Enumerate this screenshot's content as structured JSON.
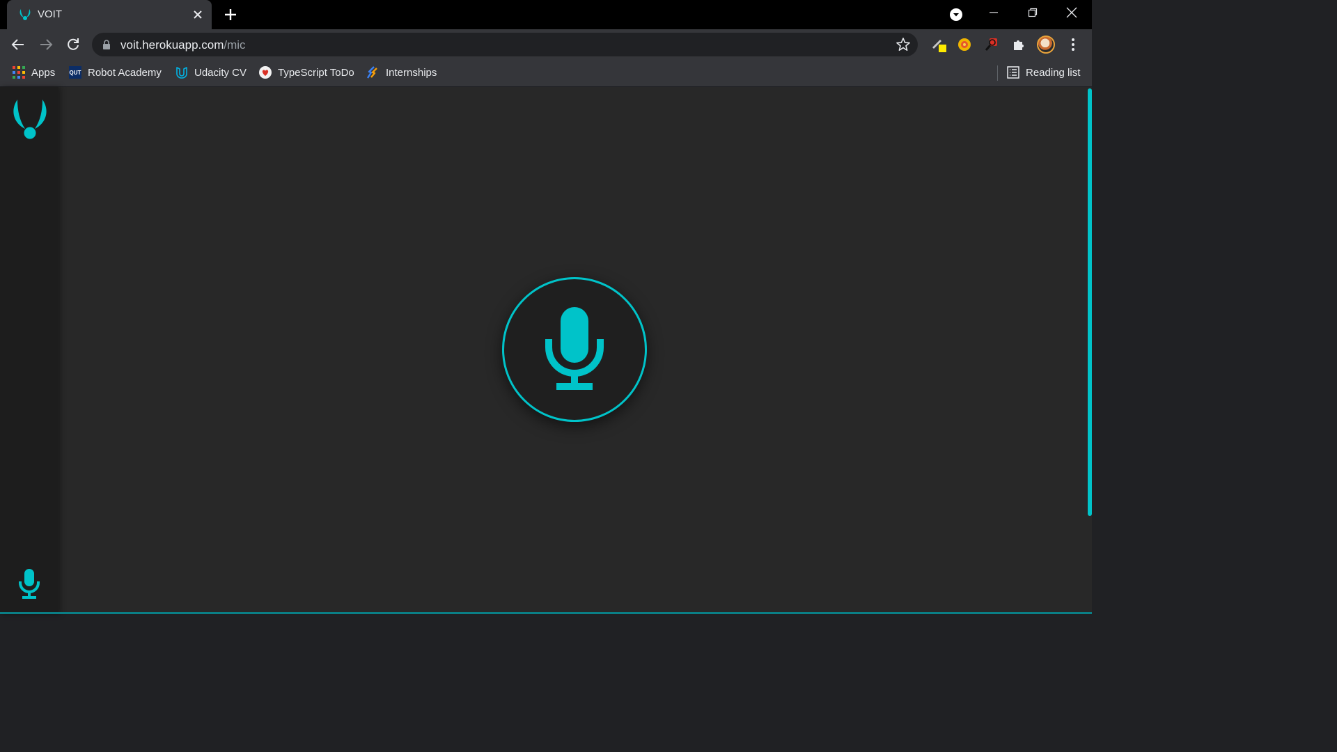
{
  "browser": {
    "tab": {
      "title": "VOIT"
    },
    "url": {
      "host": "voit.herokuapp.com",
      "path": "/mic"
    },
    "bookmarks": [
      {
        "label": "Apps",
        "icon": "apps-grid-icon"
      },
      {
        "label": "Robot Academy",
        "icon": "qut-icon",
        "badge": "QUT"
      },
      {
        "label": "Udacity CV",
        "icon": "udacity-icon"
      },
      {
        "label": "TypeScript ToDo",
        "icon": "typescript-todo-icon"
      },
      {
        "label": "Internships",
        "icon": "internships-icon"
      }
    ],
    "reading_list": "Reading list"
  },
  "app": {
    "accent_color": "#00c3c9",
    "background_color": "#282828",
    "sidebar_color": "#1d1d1d",
    "logo_icon": "voit-logo-icon",
    "sidebar_icon": "microphone-icon",
    "main_button_icon": "microphone-icon"
  }
}
